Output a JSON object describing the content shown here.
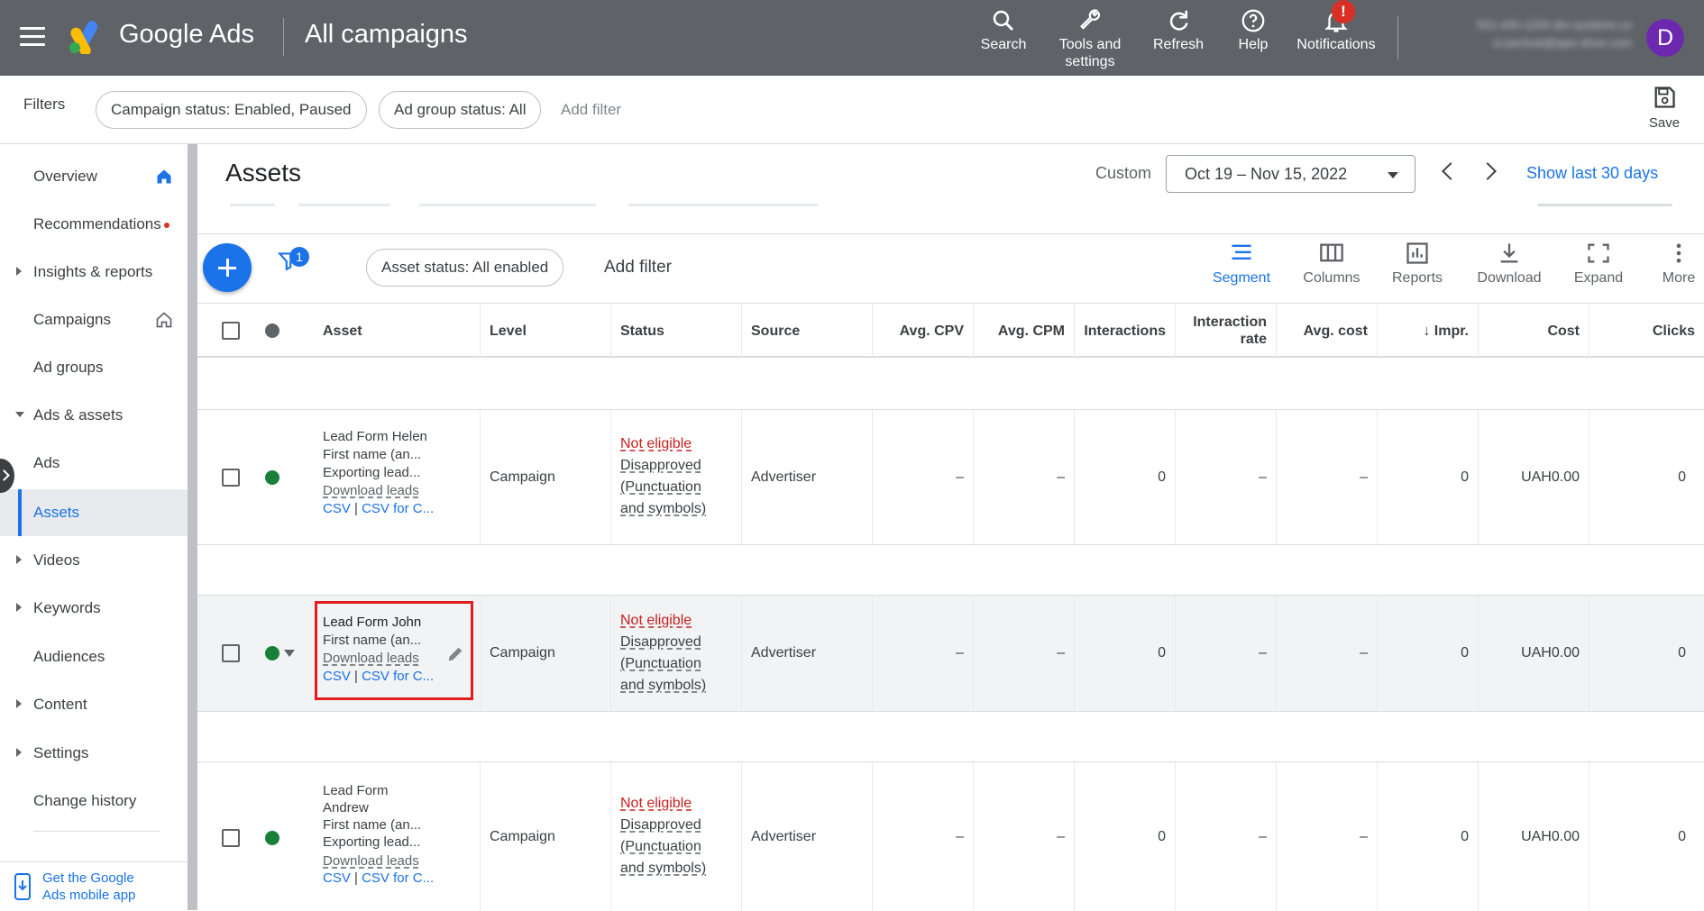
{
  "topbar": {
    "brand": "Google Ads",
    "page_name": "All campaigns",
    "buttons": [
      {
        "label": "Search",
        "icon": "search-icon"
      },
      {
        "label": "Tools and settings",
        "icon": "wrench-icon"
      },
      {
        "label": "Refresh",
        "icon": "refresh-icon"
      },
      {
        "label": "Help",
        "icon": "help-icon"
      },
      {
        "label": "Notifications",
        "icon": "bell-icon",
        "badge": "!"
      }
    ],
    "account_line1": "501-440-1204 dm-systems.co",
    "account_line2": "d.zarchuk@apix-drive.com",
    "avatar_letter": "D"
  },
  "filters": {
    "label": "Filters",
    "chips": [
      "Campaign status: Enabled, Paused",
      "Ad group status: All"
    ],
    "add_filter": "Add filter",
    "save": "Save"
  },
  "sidebar": {
    "items": [
      {
        "label": "Overview",
        "icon": "home-icon"
      },
      {
        "label": "Recommendations",
        "dot": true
      },
      {
        "label": "Insights & reports",
        "arrow": "right"
      },
      {
        "label": "Campaigns",
        "icon": "home-outline-icon"
      },
      {
        "label": "Ad groups"
      },
      {
        "label": "Ads & assets",
        "arrow": "down"
      },
      {
        "label": "Ads"
      },
      {
        "label": "Assets",
        "active": true
      },
      {
        "label": "Videos",
        "arrow": "right"
      },
      {
        "label": "Keywords",
        "arrow": "right"
      },
      {
        "label": "Audiences"
      },
      {
        "label": "Content",
        "arrow": "right"
      },
      {
        "label": "Settings",
        "arrow": "right"
      },
      {
        "label": "Change history"
      }
    ],
    "mobile_app_line1": "Get the Google",
    "mobile_app_line2": "Ads mobile app"
  },
  "header": {
    "title": "Assets",
    "custom_label": "Custom",
    "date_range": "Oct 19 – Nov 15, 2022",
    "show_last": "Show last 30 days"
  },
  "toolbar": {
    "filter_badge": "1",
    "asset_status_chip": "Asset status: All enabled",
    "add_filter": "Add filter",
    "tools": [
      {
        "label": "Segment",
        "icon": "segment-icon",
        "active": true
      },
      {
        "label": "Columns",
        "icon": "columns-icon"
      },
      {
        "label": "Reports",
        "icon": "reports-icon"
      },
      {
        "label": "Download",
        "icon": "download-icon"
      },
      {
        "label": "Expand",
        "icon": "expand-icon"
      },
      {
        "label": "More",
        "icon": "more-vert-icon"
      }
    ]
  },
  "table": {
    "headers": {
      "asset": "Asset",
      "level": "Level",
      "status": "Status",
      "source": "Source",
      "avg_cpv": "Avg. CPV",
      "avg_cpm": "Avg. CPM",
      "interactions": "Interactions",
      "interaction_rate_1": "Interaction",
      "interaction_rate_2": "rate",
      "avg_cost": "Avg. cost",
      "impr": "Impr.",
      "cost": "Cost",
      "clicks": "Clicks"
    },
    "rows": [
      {
        "asset_lines": [
          "Lead Form Helen",
          "First name (an...",
          "Exporting lead..."
        ],
        "download": "Download leads",
        "csv": "CSV",
        "sep": "|",
        "csv_for": "CSV for C...",
        "level": "Campaign",
        "status_title": "Not eligible",
        "status_lines": [
          "Disapproved",
          "(Punctuation",
          "and symbols)"
        ],
        "source": "Advertiser",
        "avg_cpv": "–",
        "avg_cpm": "–",
        "interactions": "0",
        "interaction_rate": "–",
        "avg_cost": "–",
        "impr": "0",
        "cost": "UAH0.00",
        "clicks": "0"
      },
      {
        "asset_lines": [
          "Lead Form John",
          "First name (an..."
        ],
        "download": "Download leads",
        "csv": "CSV",
        "sep": "|",
        "csv_for": "CSV for C...",
        "level": "Campaign",
        "status_title": "Not eligible",
        "status_lines": [
          "Disapproved",
          "(Punctuation",
          "and symbols)"
        ],
        "source": "Advertiser",
        "avg_cpv": "–",
        "avg_cpm": "–",
        "interactions": "0",
        "interaction_rate": "–",
        "avg_cost": "–",
        "impr": "0",
        "cost": "UAH0.00",
        "clicks": "0"
      },
      {
        "asset_lines": [
          "Lead Form",
          "Andrew",
          "First name (an...",
          "Exporting lead..."
        ],
        "download": "Download leads",
        "csv": "CSV",
        "sep": "|",
        "csv_for": "CSV for C...",
        "level": "Campaign",
        "status_title": "Not eligible",
        "status_lines": [
          "Disapproved",
          "(Punctuation",
          "and symbols)"
        ],
        "source": "Advertiser",
        "avg_cpv": "–",
        "avg_cpm": "–",
        "interactions": "0",
        "interaction_rate": "–",
        "avg_cost": "–",
        "impr": "0",
        "cost": "UAH0.00",
        "clicks": "0"
      }
    ]
  },
  "colors": {
    "topbar": "#5f6368",
    "accent": "#1a73e8",
    "status_enabled": "#188038",
    "not_eligible": "#c5221f",
    "highlight_box": "#e21d1d"
  }
}
